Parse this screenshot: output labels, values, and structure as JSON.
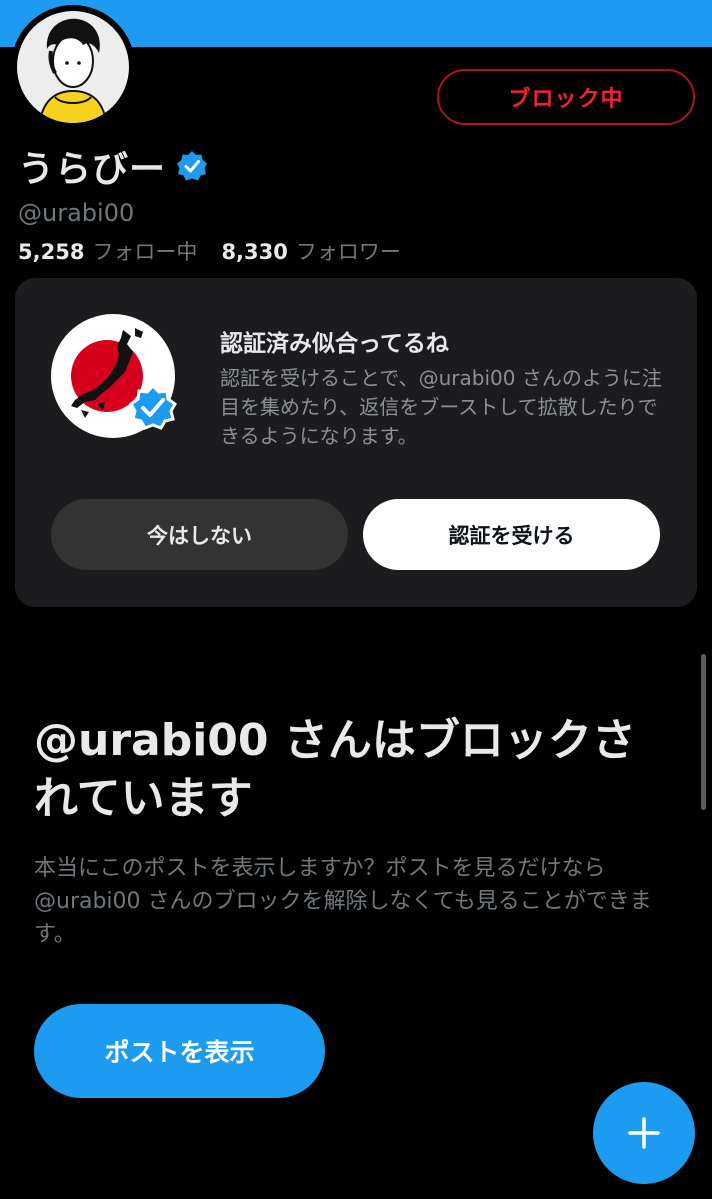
{
  "profile": {
    "block_status_label": "ブロック中",
    "display_name": "うらびー",
    "handle": "@urabi00",
    "following_count": "5,258",
    "following_label": "フォロー中",
    "followers_count": "8,330",
    "followers_label": "フォロワー",
    "banner_color": "#1d9bf0"
  },
  "promo": {
    "title": "認証済み似合ってるね",
    "body": "認証を受けることで、@urabi00 さんのように注目を集めたり、返信をブーストして拡散したりできるようになります。",
    "dismiss_label": "今はしない",
    "verify_label": "認証を受ける"
  },
  "blocked": {
    "title": "@urabi00 さんはブロックされています",
    "description": "本当にこのポストを表示しますか？ポストを見るだけなら @urabi00 さんのブロックを解除しなくても見ることができます。",
    "show_post_label": "ポストを表示"
  },
  "fab": {
    "icon": "plus-icon"
  },
  "colors": {
    "accent": "#1d9bf0",
    "danger": "#f4212e",
    "background": "#000000"
  }
}
